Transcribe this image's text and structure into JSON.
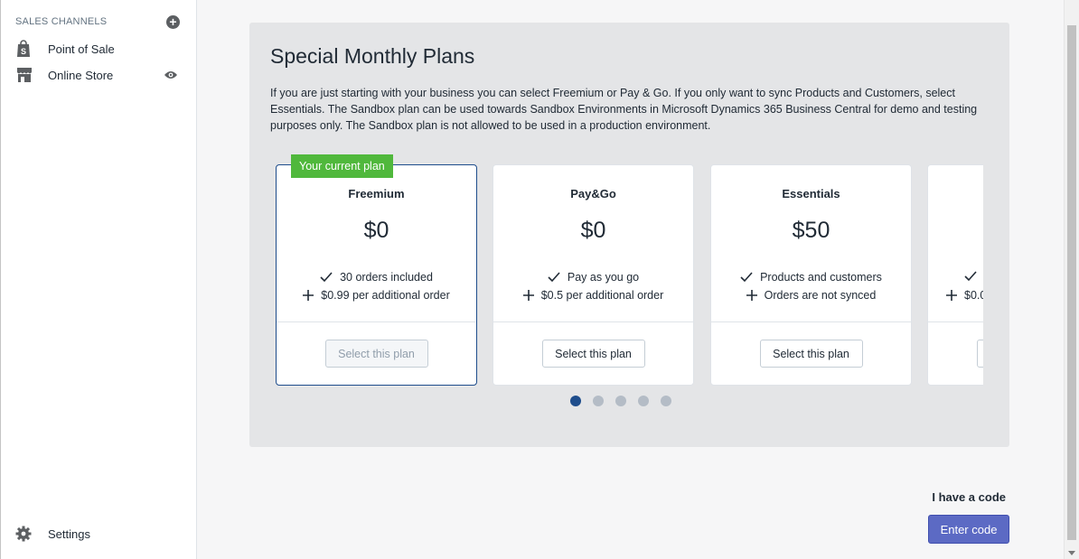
{
  "sidebar": {
    "sales_channels_label": "SALES CHANNELS",
    "add_icon": "plus-circle-icon",
    "items": [
      {
        "label": "Point of Sale",
        "icon": "shopify-bag-icon"
      },
      {
        "label": "Online Store",
        "icon": "store-icon",
        "trailing_icon": "eye-icon"
      }
    ],
    "settings": {
      "label": "Settings",
      "icon": "gear-icon"
    }
  },
  "plans_panel": {
    "title": "Special Monthly Plans",
    "description": "If you are just starting with your business you can select Freemium or Pay & Go. If you only want to sync Products and Customers, select Essentials. The Sandbox plan can be used towards Sandbox Environments in Microsoft Dynamics 365 Business Central for demo and testing purposes only. The Sandbox plan is not allowed to be used in a production environment.",
    "plans": [
      {
        "name": "Freemium",
        "price": "$0",
        "current": true,
        "badge": "Your current plan",
        "features": [
          {
            "icon": "check-icon",
            "text": "30 orders included"
          },
          {
            "icon": "plus-icon",
            "text": "$0.99 per additional order"
          }
        ],
        "button": "Select this plan"
      },
      {
        "name": "Pay&Go",
        "price": "$0",
        "current": false,
        "features": [
          {
            "icon": "check-icon",
            "text": "Pay as you go"
          },
          {
            "icon": "plus-icon",
            "text": "$0.5 per additional order"
          }
        ],
        "button": "Select this plan"
      },
      {
        "name": "Essentials",
        "price": "$50",
        "current": false,
        "features": [
          {
            "icon": "check-icon",
            "text": "Products and customers"
          },
          {
            "icon": "plus-icon",
            "text": "Orders are not synced"
          }
        ],
        "button": "Select this plan"
      },
      {
        "name": "",
        "price": "",
        "current": false,
        "features": [
          {
            "icon": "check-icon",
            "text": ""
          },
          {
            "icon": "plus-icon",
            "text": "$0.0"
          }
        ],
        "button": ""
      }
    ],
    "pagination": {
      "total": 5,
      "active": 1
    }
  },
  "code": {
    "label": "I have a code",
    "button": "Enter code"
  },
  "colors": {
    "accent": "#5c6ac4",
    "current_plan_border": "#1e4d8c",
    "badge": "#50b83c",
    "panel_bg": "#e4e5e7"
  }
}
